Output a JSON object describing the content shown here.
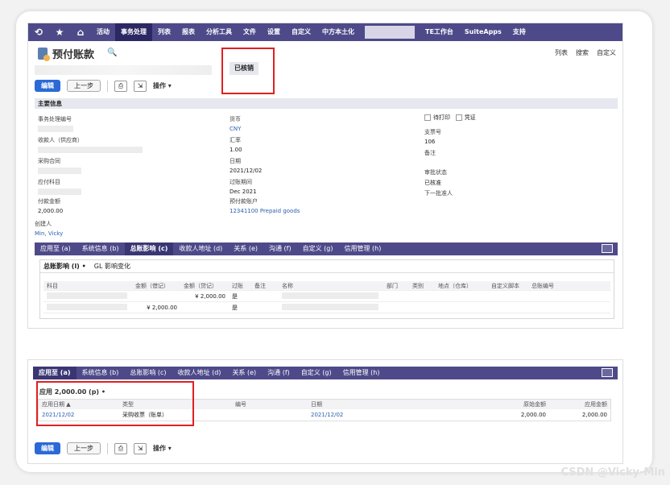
{
  "nav": {
    "items": [
      "活动",
      "事务处理",
      "列表",
      "报表",
      "分析工具",
      "文件",
      "设置",
      "自定义",
      "中方本土化",
      "TE工作台",
      "SuiteApps",
      "支持"
    ],
    "active_index": 1
  },
  "title": {
    "text": "预付账款",
    "right_links": [
      "列表",
      "搜索",
      "自定义"
    ]
  },
  "status": "已核销",
  "toolbar": {
    "edit": "编辑",
    "prev": "上一步",
    "actions": "操作"
  },
  "section": "主要信息",
  "fields": {
    "txn_no_label": "事务处理编号",
    "payee_label": "收款人（供应商）",
    "po_label": "采购合同",
    "ap_account_label": "应付科目",
    "pay_amount_label": "付款金额",
    "pay_amount_value": "2,000.00",
    "creator_label": "创建人",
    "creator_value": "Min, Vicky",
    "currency_label": "货币",
    "currency_value": "CNY",
    "rate_label": "汇率",
    "rate_value": "1.00",
    "date_label": "日期",
    "date_value": "2021/12/02",
    "period_label": "过账期间",
    "period_value": "Dec 2021",
    "prepay_account_label": "预付款账户",
    "prepay_account_value": "12341100 Prepaid goods",
    "to_print_label": "待打印",
    "voucher_label": "凭证",
    "check_no_label": "支票号",
    "check_no_value": "106",
    "memo_label": "备注",
    "approval_label": "审批状态",
    "approval_value": "已核准",
    "next_approver_label": "下一批准人"
  },
  "subtabs": [
    "应用至 (a)",
    "系统信息 (b)",
    "总账影响 (c)",
    "收款人地址 (d)",
    "关系 (e)",
    "沟通 (f)",
    "自定义 (g)",
    "信用管理 (h)"
  ],
  "subtabs_active": 2,
  "gl": {
    "tabs": [
      "总账影响 (l) •",
      "GL 影响变化"
    ],
    "headers": [
      "科目",
      "金额（借记）",
      "金额（贷记）",
      "过账",
      "备注",
      "名称",
      "部门",
      "类别",
      "地点（仓库）",
      "自定义脚本",
      "总账编号"
    ],
    "rows": [
      {
        "debit": "",
        "credit": "¥ 2,000.00",
        "posted": "是"
      },
      {
        "debit": "¥ 2,000.00",
        "credit": "",
        "posted": "是"
      }
    ]
  },
  "apply": {
    "subtabs": [
      "应用至 (a)",
      "系统信息 (b)",
      "总账影响 (c)",
      "收款人地址 (d)",
      "关系 (e)",
      "沟通 (f)",
      "自定义 (g)",
      "信用管理 (h)"
    ],
    "header": "应用 2,000.00 (p) •",
    "columns": [
      "应用日期 ▲",
      "类型",
      "编号",
      "日期",
      "原始金额",
      "应用金额"
    ],
    "row": [
      "2021/12/02",
      "采购收票（账单）",
      "",
      "2021/12/02",
      "2,000.00",
      "2,000.00"
    ]
  },
  "watermark": "CSDN @Vicky-Min",
  "colors": {
    "nav": "#4e4a8a",
    "nav_active": "#2b2864",
    "primary_button": "#2b6ad6",
    "highlight_border": "#e02020",
    "link": "#2b5fb0"
  }
}
